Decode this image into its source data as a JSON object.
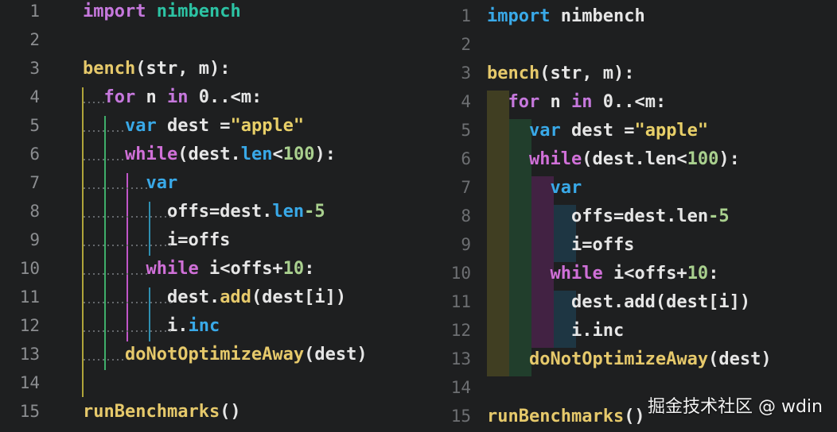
{
  "left": {
    "lines": [
      {
        "num": "1",
        "tokens": [
          {
            "t": "import",
            "c": "kw"
          },
          {
            "t": " "
          },
          {
            "t": "nimbench",
            "c": "lib"
          }
        ]
      },
      {
        "num": "2",
        "tokens": []
      },
      {
        "num": "3",
        "tokens": [
          {
            "t": "bench",
            "c": "fn"
          },
          {
            "t": "(str, m):"
          }
        ]
      },
      {
        "num": "4",
        "tokens": [
          {
            "t": "  "
          },
          {
            "t": "for",
            "c": "kw"
          },
          {
            "t": " n "
          },
          {
            "t": "in",
            "c": "kw"
          },
          {
            "t": " 0..<m:"
          }
        ]
      },
      {
        "num": "5",
        "tokens": [
          {
            "t": "    "
          },
          {
            "t": "var",
            "c": "prop"
          },
          {
            "t": " dest ="
          },
          {
            "t": "\"apple\"",
            "c": "str"
          }
        ]
      },
      {
        "num": "6",
        "tokens": [
          {
            "t": "    "
          },
          {
            "t": "while",
            "c": "kw2"
          },
          {
            "t": "(dest."
          },
          {
            "t": "len",
            "c": "prop"
          },
          {
            "t": "<"
          },
          {
            "t": "100",
            "c": "num"
          },
          {
            "t": "):"
          }
        ]
      },
      {
        "num": "7",
        "tokens": [
          {
            "t": "      "
          },
          {
            "t": "var",
            "c": "prop"
          }
        ]
      },
      {
        "num": "8",
        "tokens": [
          {
            "t": "        offs=dest."
          },
          {
            "t": "len",
            "c": "prop"
          },
          {
            "t": "-5",
            "c": "num"
          }
        ]
      },
      {
        "num": "9",
        "tokens": [
          {
            "t": "        i=offs"
          }
        ]
      },
      {
        "num": "10",
        "tokens": [
          {
            "t": "      "
          },
          {
            "t": "while",
            "c": "kw2"
          },
          {
            "t": " i<offs+"
          },
          {
            "t": "10",
            "c": "num"
          },
          {
            "t": ":"
          }
        ]
      },
      {
        "num": "11",
        "tokens": [
          {
            "t": "        dest."
          },
          {
            "t": "add",
            "c": "fn"
          },
          {
            "t": "(dest[i])"
          }
        ]
      },
      {
        "num": "12",
        "tokens": [
          {
            "t": "        i."
          },
          {
            "t": "inc",
            "c": "prop"
          }
        ]
      },
      {
        "num": "13",
        "tokens": [
          {
            "t": "    "
          },
          {
            "t": "doNotOptimizeAway",
            "c": "fn"
          },
          {
            "t": "(dest)"
          }
        ]
      },
      {
        "num": "14",
        "tokens": []
      },
      {
        "num": "15",
        "tokens": [
          {
            "t": "runBenchmarks",
            "c": "fn"
          },
          {
            "t": "()"
          }
        ]
      }
    ]
  },
  "right": {
    "lines": [
      {
        "num": "1",
        "tokens": [
          {
            "t": "import",
            "c": "prop"
          },
          {
            "t": " nimbench"
          }
        ]
      },
      {
        "num": "2",
        "tokens": []
      },
      {
        "num": "3",
        "tokens": [
          {
            "t": "bench",
            "c": "fn"
          },
          {
            "t": "(str, m):"
          }
        ]
      },
      {
        "num": "4",
        "tokens": [
          {
            "t": "  "
          },
          {
            "t": "for",
            "c": "kw"
          },
          {
            "t": " n "
          },
          {
            "t": "in",
            "c": "kw"
          },
          {
            "t": " 0..<m:"
          }
        ]
      },
      {
        "num": "5",
        "tokens": [
          {
            "t": "    "
          },
          {
            "t": "var",
            "c": "prop"
          },
          {
            "t": " dest ="
          },
          {
            "t": "\"apple\"",
            "c": "str"
          }
        ]
      },
      {
        "num": "6",
        "tokens": [
          {
            "t": "    "
          },
          {
            "t": "while",
            "c": "kw2"
          },
          {
            "t": "(dest.len<"
          },
          {
            "t": "100",
            "c": "num"
          },
          {
            "t": "):"
          }
        ]
      },
      {
        "num": "7",
        "tokens": [
          {
            "t": "      "
          },
          {
            "t": "var",
            "c": "prop"
          }
        ]
      },
      {
        "num": "8",
        "tokens": [
          {
            "t": "        offs=dest.len"
          },
          {
            "t": "-5",
            "c": "num"
          }
        ]
      },
      {
        "num": "9",
        "tokens": [
          {
            "t": "        i=offs"
          }
        ]
      },
      {
        "num": "10",
        "tokens": [
          {
            "t": "      "
          },
          {
            "t": "while",
            "c": "kw2"
          },
          {
            "t": " i<offs+"
          },
          {
            "t": "10",
            "c": "num"
          },
          {
            "t": ":"
          }
        ]
      },
      {
        "num": "11",
        "tokens": [
          {
            "t": "        dest.add(dest[i])"
          }
        ]
      },
      {
        "num": "12",
        "tokens": [
          {
            "t": "        i.inc"
          }
        ]
      },
      {
        "num": "13",
        "tokens": [
          {
            "t": "    "
          },
          {
            "t": "doNotOptimizeAway",
            "c": "fn"
          },
          {
            "t": "(dest)"
          }
        ]
      },
      {
        "num": "14",
        "tokens": []
      },
      {
        "num": "15",
        "tokens": [
          {
            "t": "runBenchmarks",
            "c": "fn"
          },
          {
            "t": "()"
          }
        ]
      }
    ]
  },
  "watermark": "掘金技术社区 @ wdin",
  "colors": {
    "background": "#1e1f20",
    "keyword": "#c678dd",
    "module": "#2cc3a4",
    "function": "#e6c96b",
    "property": "#39a9e8",
    "number": "#a9d08e",
    "string": "#e8cf68"
  }
}
